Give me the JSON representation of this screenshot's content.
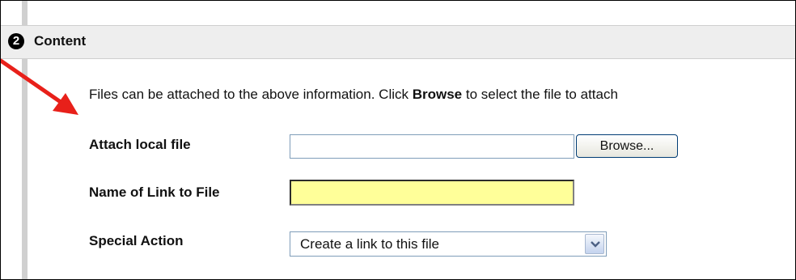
{
  "section": {
    "step_number": "2",
    "title": "Content"
  },
  "instructions": {
    "prefix": "Files can be attached to the above information. Click ",
    "bold": "Browse",
    "suffix": " to select the file to attach"
  },
  "fields": {
    "attach_local_file": {
      "label": "Attach local file",
      "value": "",
      "button_label": "Browse..."
    },
    "link_name": {
      "label": "Name of Link to File",
      "value": ""
    },
    "special_action": {
      "label": "Special Action",
      "selected": "Create a link to this file"
    }
  },
  "colors": {
    "arrow": "#e8201a",
    "highlight_field": "#ffff99",
    "header_bg": "#eeeeee"
  },
  "icons": {
    "annotation_arrow": "red-arrow-icon",
    "dropdown": "chevron-down-icon"
  }
}
